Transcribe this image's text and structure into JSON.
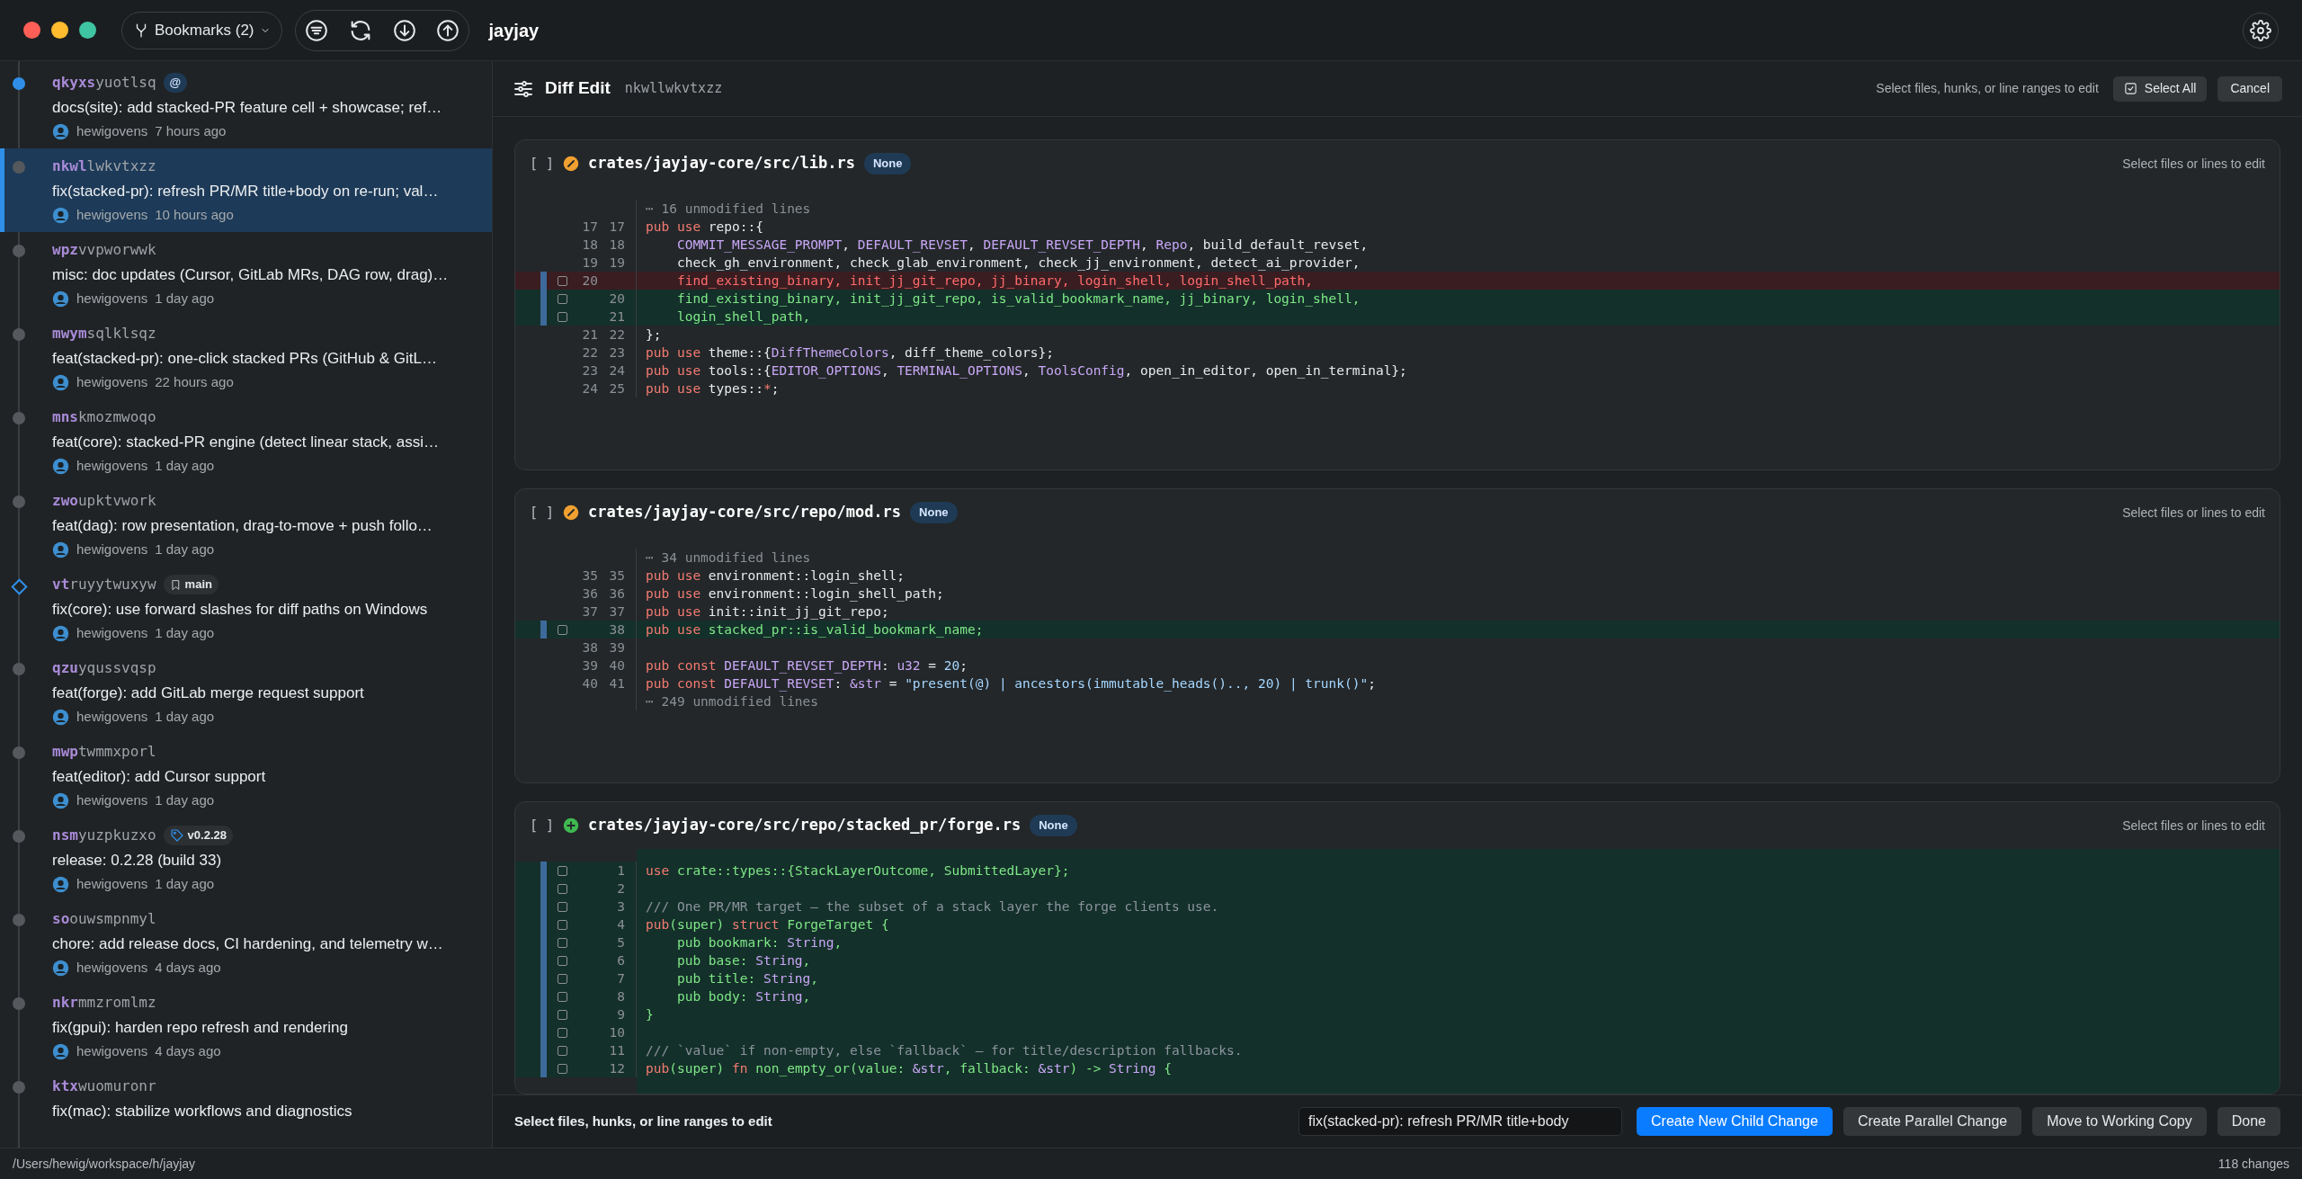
{
  "window": {
    "title": "jayjay"
  },
  "toolbar": {
    "bookmarks_button": "Bookmarks (2)"
  },
  "commits": [
    {
      "prefix": "qkyxs",
      "rest": "yuotlsq",
      "kind": "current",
      "badge": {
        "kind": "working",
        "label": "@"
      },
      "title": "docs(site): add stacked-PR feature cell + showcase; ref…",
      "author": "hewigovens",
      "time": "7 hours ago",
      "selected": false
    },
    {
      "prefix": "nkwl",
      "rest": "lwkvtxzz",
      "kind": "commit",
      "title": "fix(stacked-pr): refresh PR/MR title+body on re-run; val…",
      "author": "hewigovens",
      "time": "10 hours ago",
      "selected": true
    },
    {
      "prefix": "wpz",
      "rest": "vvpworwwk",
      "kind": "commit",
      "title": "misc: doc updates (Cursor, GitLab MRs, DAG row, drag)…",
      "author": "hewigovens",
      "time": "1 day ago",
      "selected": false
    },
    {
      "prefix": "mwym",
      "rest": "sqlklsqz",
      "kind": "commit",
      "title": "feat(stacked-pr): one-click stacked PRs (GitHub & GitL…",
      "author": "hewigovens",
      "time": "22 hours ago",
      "selected": false
    },
    {
      "prefix": "mns",
      "rest": "kmozmwoqo",
      "kind": "commit",
      "title": "feat(core): stacked-PR engine (detect linear stack, assi…",
      "author": "hewigovens",
      "time": "1 day ago",
      "selected": false
    },
    {
      "prefix": "zwo",
      "rest": "upktvwork",
      "kind": "commit",
      "title": "feat(dag): row presentation, drag-to-move + push follo…",
      "author": "hewigovens",
      "time": "1 day ago",
      "selected": false
    },
    {
      "prefix": "vt",
      "rest": "ruyytwuxyw",
      "kind": "bookmark",
      "badge": {
        "kind": "bookmark",
        "label": "main"
      },
      "title": "fix(core): use forward slashes for diff paths on Windows",
      "author": "hewigovens",
      "time": "1 day ago",
      "selected": false
    },
    {
      "prefix": "qzu",
      "rest": "yqussvqsp",
      "kind": "commit",
      "title": "feat(forge): add GitLab merge request support",
      "author": "hewigovens",
      "time": "1 day ago",
      "selected": false
    },
    {
      "prefix": "mwp",
      "rest": "twmmxporl",
      "kind": "commit",
      "title": "feat(editor): add Cursor support",
      "author": "hewigovens",
      "time": "1 day ago",
      "selected": false
    },
    {
      "prefix": "nsm",
      "rest": "yuzpkuzxo",
      "kind": "commit",
      "badge": {
        "kind": "tag",
        "label": "v0.2.28"
      },
      "title": "release: 0.2.28 (build 33)",
      "author": "hewigovens",
      "time": "1 day ago",
      "selected": false
    },
    {
      "prefix": "so",
      "rest": "ouwsmpnmyl",
      "kind": "commit",
      "title": "chore: add release docs, CI hardening, and telemetry w…",
      "author": "hewigovens",
      "time": "4 days ago",
      "selected": false
    },
    {
      "prefix": "nkr",
      "rest": "mmzromlmz",
      "kind": "commit",
      "title": "fix(gpui): harden repo refresh and rendering",
      "author": "hewigovens",
      "time": "4 days ago",
      "selected": false
    },
    {
      "prefix": "ktx",
      "rest": "wuomuronr",
      "kind": "commit",
      "title": "fix(mac): stabilize workflows and diagnostics",
      "selected": false
    }
  ],
  "diff_edit": {
    "title": "Diff Edit",
    "change_id": "nkwllwkvtxzz",
    "hint": "Select files, hunks, or line ranges to edit",
    "select_all_button": "Select All",
    "cancel_button": "Cancel"
  },
  "files": [
    {
      "bracket": "[ ]",
      "checked": false,
      "kind": "modified",
      "path": "crates/jayjay-core/src/lib.rs",
      "badge": "None",
      "hint": "Select files or lines to edit",
      "lines": [
        {
          "kind": "fold",
          "text": "⋯ 16 unmodified lines"
        },
        {
          "kind": "context",
          "old": "17",
          "new": "17",
          "code": [
            {
              "text": "pub use",
              "kind": "keyword"
            },
            {
              "text": " repo::{"
            }
          ]
        },
        {
          "kind": "context",
          "old": "18",
          "new": "18",
          "code": [
            {
              "text": "    COMMIT_MESSAGE_PROMPT",
              "kind": "type"
            },
            {
              "text": ", "
            },
            {
              "text": "DEFAULT_REVSET",
              "kind": "type"
            },
            {
              "text": ", "
            },
            {
              "text": "DEFAULT_REVSET_DEPTH",
              "kind": "type"
            },
            {
              "text": ", "
            },
            {
              "text": "Repo",
              "kind": "type"
            },
            {
              "text": ", build_default_revset,"
            }
          ]
        },
        {
          "kind": "context",
          "old": "19",
          "new": "19",
          "code": [
            {
              "text": "    check_gh_environment, check_glab_environment, check_jj_environment, detect_ai_provider,"
            }
          ]
        },
        {
          "kind": "removed",
          "old": "20",
          "checked": false,
          "code": [
            {
              "text": "    find_existing_binary, init_jj_git_repo, jj_binary, login_shell, login_shell_path,"
            }
          ]
        },
        {
          "kind": "added",
          "new": "20",
          "checked": false,
          "code": [
            {
              "text": "    find_existing_binary, init_jj_git_repo, is_valid_bookmark_name, jj_binary, login_shell,"
            }
          ]
        },
        {
          "kind": "added",
          "new": "21",
          "checked": false,
          "code": [
            {
              "text": "    login_shell_path,"
            }
          ]
        },
        {
          "kind": "context",
          "old": "21",
          "new": "22",
          "code": [
            {
              "text": "};"
            }
          ]
        },
        {
          "kind": "context",
          "old": "22",
          "new": "23",
          "code": [
            {
              "text": "pub use",
              "kind": "keyword"
            },
            {
              "text": " theme::{"
            },
            {
              "text": "DiffThemeColors",
              "kind": "type"
            },
            {
              "text": ", diff_theme_colors};"
            }
          ]
        },
        {
          "kind": "context",
          "old": "23",
          "new": "24",
          "code": [
            {
              "text": "pub use",
              "kind": "keyword"
            },
            {
              "text": " tools::{"
            },
            {
              "text": "EDITOR_OPTIONS",
              "kind": "type"
            },
            {
              "text": ", "
            },
            {
              "text": "TERMINAL_OPTIONS",
              "kind": "type"
            },
            {
              "text": ", "
            },
            {
              "text": "ToolsConfig",
              "kind": "type"
            },
            {
              "text": ", open_in_editor, open_in_terminal};"
            }
          ]
        },
        {
          "kind": "context",
          "old": "24",
          "new": "25",
          "code": [
            {
              "text": "pub use",
              "kind": "keyword"
            },
            {
              "text": " types::"
            },
            {
              "text": "*",
              "kind": "keyword"
            },
            {
              "text": ";"
            }
          ]
        }
      ]
    },
    {
      "bracket": "[ ]",
      "checked": false,
      "kind": "modified",
      "path": "crates/jayjay-core/src/repo/mod.rs",
      "badge": "None",
      "hint": "Select files or lines to edit",
      "lines": [
        {
          "kind": "fold",
          "text": "⋯ 34 unmodified lines"
        },
        {
          "kind": "context",
          "old": "35",
          "new": "35",
          "code": [
            {
              "text": "pub use",
              "kind": "keyword"
            },
            {
              "text": " environment::login_shell;"
            }
          ]
        },
        {
          "kind": "context",
          "old": "36",
          "new": "36",
          "code": [
            {
              "text": "pub use",
              "kind": "keyword"
            },
            {
              "text": " environment::login_shell_path;"
            }
          ]
        },
        {
          "kind": "context",
          "old": "37",
          "new": "37",
          "code": [
            {
              "text": "pub use",
              "kind": "keyword"
            },
            {
              "text": " init::init_jj_git_repo;"
            }
          ]
        },
        {
          "kind": "added",
          "new": "38",
          "checked": false,
          "code": [
            {
              "text": "pub use",
              "kind": "keyword"
            },
            {
              "text": " stacked_pr::is_valid_bookmark_name;"
            }
          ]
        },
        {
          "kind": "context",
          "old": "38",
          "new": "39"
        },
        {
          "kind": "context",
          "old": "39",
          "new": "40",
          "code": [
            {
              "text": "pub const ",
              "kind": "keyword"
            },
            {
              "text": "DEFAULT_REVSET_DEPTH",
              "kind": "type"
            },
            {
              "text": ": "
            },
            {
              "text": "u32",
              "kind": "type"
            },
            {
              "text": " = "
            },
            {
              "text": "20",
              "kind": "string"
            },
            {
              "text": ";"
            }
          ]
        },
        {
          "kind": "context",
          "old": "40",
          "new": "41",
          "code": [
            {
              "text": "pub const ",
              "kind": "keyword"
            },
            {
              "text": "DEFAULT_REVSET",
              "kind": "type"
            },
            {
              "text": ": "
            },
            {
              "text": "&str",
              "kind": "type"
            },
            {
              "text": " = "
            },
            {
              "text": "\"present(@) | ancestors(immutable_heads().., 20) | trunk()\"",
              "kind": "string"
            },
            {
              "text": ";"
            }
          ]
        },
        {
          "kind": "fold",
          "text": "⋯ 249 unmodified lines"
        }
      ]
    },
    {
      "bracket": "[ ]",
      "checked": false,
      "kind": "added",
      "path": "crates/jayjay-core/src/repo/stacked_pr/forge.rs",
      "badge": "None",
      "hint": "Select files or lines to edit",
      "lines": [
        {
          "kind": "added",
          "new": "1",
          "checked": false,
          "code": [
            {
              "text": "use",
              "kind": "keyword"
            },
            {
              "text": " crate::types::{StackLayerOutcome, SubmittedLayer};"
            }
          ]
        },
        {
          "kind": "added",
          "new": "2",
          "checked": false
        },
        {
          "kind": "added",
          "new": "3",
          "checked": false,
          "code": [
            {
              "text": "/// One PR/MR target — the subset of a stack layer the forge clients use.",
              "kind": "comment"
            }
          ]
        },
        {
          "kind": "added",
          "new": "4",
          "checked": false,
          "code": [
            {
              "text": "pub",
              "kind": "keyword"
            },
            {
              "text": "(super) "
            },
            {
              "text": "struct",
              "kind": "keyword"
            },
            {
              "text": " ForgeTarget {"
            }
          ]
        },
        {
          "kind": "added",
          "new": "5",
          "checked": false,
          "code": [
            {
              "text": "    pub bookmark: "
            },
            {
              "text": "String",
              "kind": "type"
            },
            {
              "text": ","
            }
          ]
        },
        {
          "kind": "added",
          "new": "6",
          "checked": false,
          "code": [
            {
              "text": "    pub base: "
            },
            {
              "text": "String",
              "kind": "type"
            },
            {
              "text": ","
            }
          ]
        },
        {
          "kind": "added",
          "new": "7",
          "checked": false,
          "code": [
            {
              "text": "    pub title: "
            },
            {
              "text": "String",
              "kind": "type"
            },
            {
              "text": ","
            }
          ]
        },
        {
          "kind": "added",
          "new": "8",
          "checked": false,
          "code": [
            {
              "text": "    pub body: "
            },
            {
              "text": "String",
              "kind": "type"
            },
            {
              "text": ","
            }
          ]
        },
        {
          "kind": "added",
          "new": "9",
          "checked": false,
          "code": [
            {
              "text": "}"
            }
          ]
        },
        {
          "kind": "added",
          "new": "10",
          "checked": false
        },
        {
          "kind": "added",
          "new": "11",
          "checked": false,
          "code": [
            {
              "text": "/// `value` if non-empty, else `fallback` — for title/description fallbacks.",
              "kind": "comment"
            }
          ]
        },
        {
          "kind": "added",
          "new": "12",
          "checked": false,
          "code": [
            {
              "text": "pub",
              "kind": "keyword"
            },
            {
              "text": "(super) "
            },
            {
              "text": "fn",
              "kind": "keyword"
            },
            {
              "text": " non_empty_or(value: "
            },
            {
              "text": "&str",
              "kind": "type"
            },
            {
              "text": ", fallback: "
            },
            {
              "text": "&str",
              "kind": "type"
            },
            {
              "text": ") -> "
            },
            {
              "text": "String",
              "kind": "type"
            },
            {
              "text": " {"
            }
          ]
        }
      ]
    }
  ],
  "action_bar": {
    "hint": "Select files, hunks, or line ranges to edit",
    "description": "fix(stacked-pr): refresh PR/MR title+body",
    "buttons": [
      {
        "label": "Create New Child Change",
        "kind": "primary"
      },
      {
        "label": "Create Parallel Change",
        "kind": "secondary"
      },
      {
        "label": "Move to Working Copy",
        "kind": "secondary"
      },
      {
        "label": "Done",
        "kind": "secondary"
      }
    ]
  },
  "status_bar": {
    "path": "/Users/hewig/workspace/h/jayjay",
    "changes": "118 changes"
  }
}
